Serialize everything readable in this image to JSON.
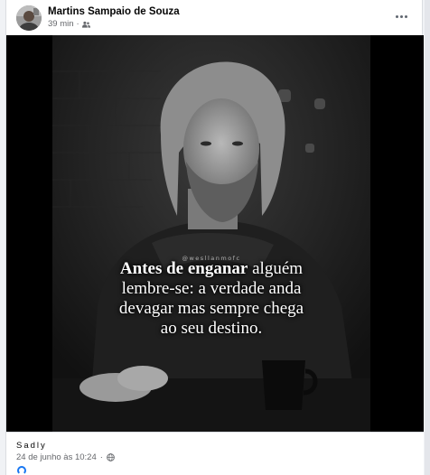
{
  "post": {
    "author": "Martins Sampaio de Souza",
    "time": "39 min",
    "audience_icon": "friends-icon",
    "more_icon": "more-options-icon",
    "watermark": "@wesllanmofc",
    "quote": {
      "line1_bold": "Antes de enganar",
      "line1_rest": " alguém",
      "line2": "lembre-se: a verdade anda",
      "line3": "devagar mas sempre chega",
      "line4": "ao seu destino."
    },
    "caption": "Sadly",
    "date": "24 de junho às 10:24",
    "date_separator": "·",
    "privacy_icon": "globe-icon"
  },
  "colors": {
    "page_bg": "#f0f2f5",
    "card_bg": "#ffffff",
    "text_primary": "#050505",
    "text_secondary": "#65676b",
    "photo_bg": "#000000"
  }
}
